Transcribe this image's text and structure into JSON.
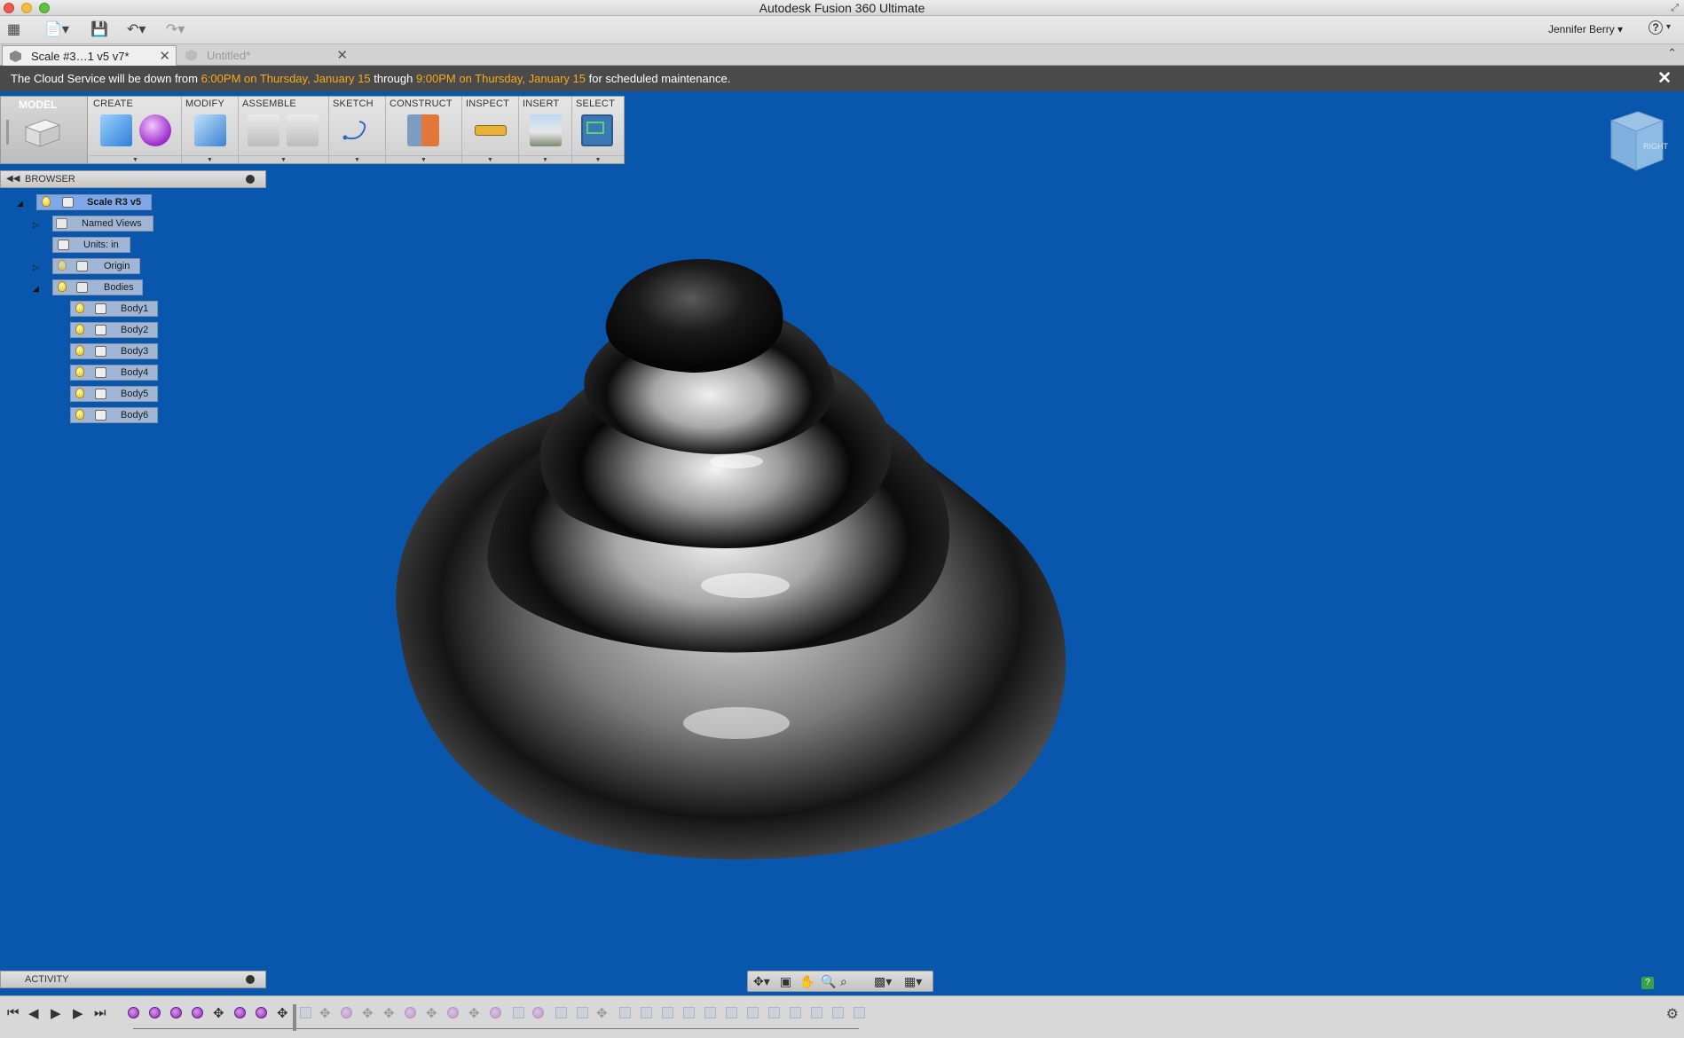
{
  "window": {
    "title": "Autodesk Fusion 360 Ultimate"
  },
  "toolbar": {
    "user_name": "Jennifer Berry ▾",
    "help_label": "?"
  },
  "tabs": [
    {
      "label": "Scale #3…1 v5 v7*",
      "active": true
    },
    {
      "label": "Untitled*",
      "active": false
    }
  ],
  "banner": {
    "prefix": "The Cloud Service will be down from ",
    "start": "6:00PM on Thursday, January 15",
    "mid": " through ",
    "end": "9:00PM on Thursday, January 15",
    "suffix": " for scheduled maintenance.",
    "close_label": "✕"
  },
  "ribbon": {
    "workspace": "MODEL",
    "groups": [
      {
        "label": "CREATE"
      },
      {
        "label": "MODIFY"
      },
      {
        "label": "ASSEMBLE"
      },
      {
        "label": "SKETCH"
      },
      {
        "label": "CONSTRUCT"
      },
      {
        "label": "INSPECT"
      },
      {
        "label": "INSERT"
      },
      {
        "label": "SELECT"
      }
    ]
  },
  "browser": {
    "title": "BROWSER",
    "root": "Scale R3 v5",
    "named_views": "Named Views",
    "units": "Units: in",
    "origin": "Origin",
    "bodies": "Bodies",
    "body_items": [
      "Body1",
      "Body2",
      "Body3",
      "Body4",
      "Body5",
      "Body6"
    ]
  },
  "activity": {
    "title": "ACTIVITY"
  },
  "viewcube": {
    "face_label": "RIGHT"
  },
  "colors": {
    "viewport_bg": "#0857ad",
    "banner_highlight": "#f7a81c",
    "timeline_feature": "#8a1fb0"
  }
}
